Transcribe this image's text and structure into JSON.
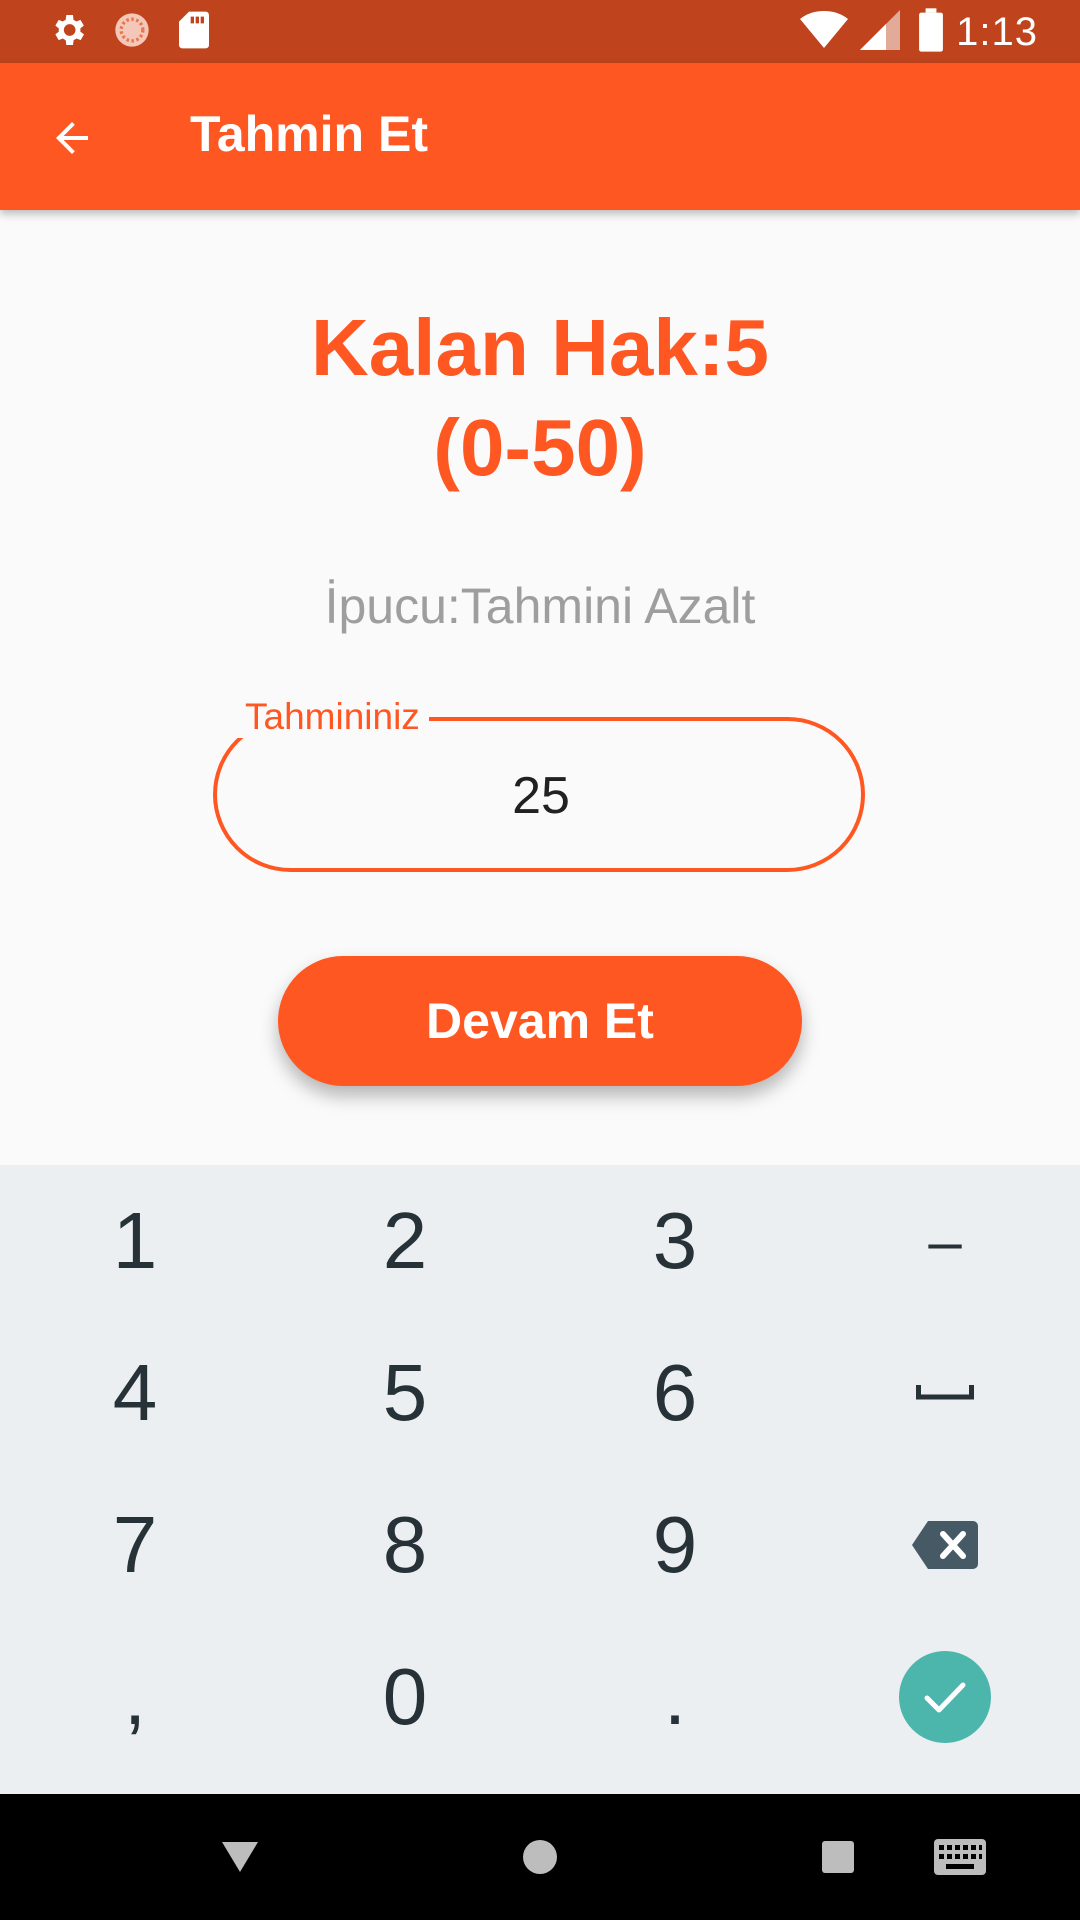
{
  "status_bar": {
    "time": "1:13",
    "left_icons": [
      "settings-icon",
      "app-notification-icon",
      "sd-card-icon"
    ],
    "right_icons": [
      "wifi-icon",
      "cell-signal-icon",
      "battery-icon"
    ]
  },
  "app_bar": {
    "title": "Tahmin Et",
    "back_icon": "arrow-back-icon",
    "color": "#ff5722"
  },
  "game": {
    "remaining_line1": "Kalan Hak:5",
    "range_line2": "(0-50)",
    "hint": "İpucu:Tahmini Azalt"
  },
  "guess_field": {
    "label": "Tahmininiz",
    "value": "25"
  },
  "continue_button": {
    "label": "Devam Et"
  },
  "keyboard": {
    "keys": [
      [
        "1",
        "2",
        "3",
        "–"
      ],
      [
        "4",
        "5",
        "6",
        "space"
      ],
      [
        "7",
        "8",
        "9",
        "backspace"
      ],
      [
        ",",
        "0",
        ".",
        "done"
      ]
    ],
    "done_color": "#4db6ac"
  },
  "nav_bar": {
    "buttons": [
      "back-triangle-icon",
      "home-circle-icon",
      "recents-square-icon",
      "keyboard-switch-icon"
    ]
  }
}
